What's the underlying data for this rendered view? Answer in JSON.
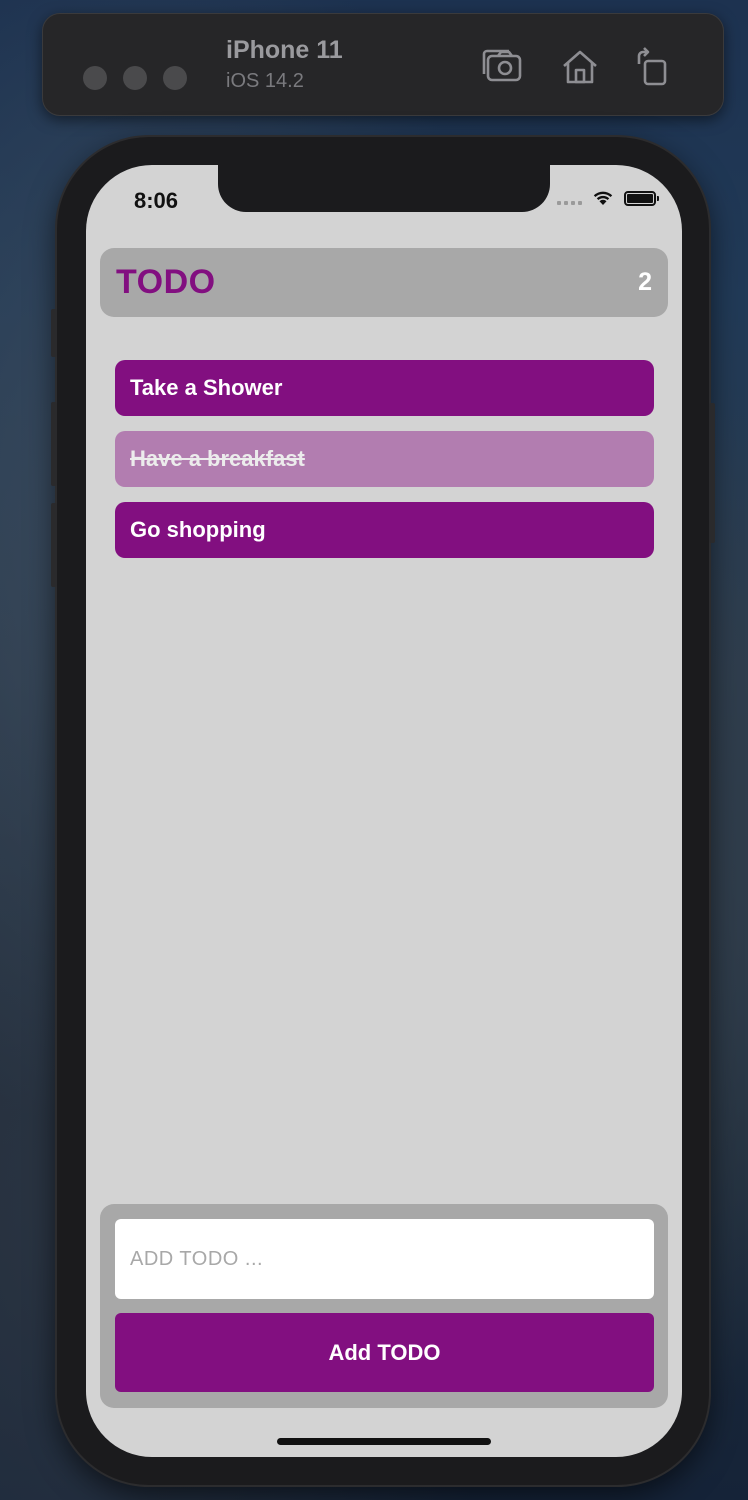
{
  "simulator": {
    "device_name": "iPhone 11",
    "os_version": "iOS 14.2",
    "toolbar_icons": [
      "screenshot-icon",
      "home-icon",
      "rotate-icon"
    ]
  },
  "status_bar": {
    "time": "8:06",
    "icons": [
      "cellular-signal-icon",
      "wifi-icon",
      "battery-icon"
    ]
  },
  "header": {
    "title": "TODO",
    "count": "2"
  },
  "todos": [
    {
      "label": "Take a Shower",
      "completed": false
    },
    {
      "label": "Have a breakfast",
      "completed": true
    },
    {
      "label": "Go shopping",
      "completed": false
    }
  ],
  "add_form": {
    "input_value": "",
    "input_placeholder": "ADD TODO ...",
    "button_label": "Add TODO"
  },
  "colors": {
    "accent": "#820f80",
    "accent_done": "#b27db0",
    "panel": "#a8a8a8",
    "screen_bg": "#d3d3d3"
  }
}
